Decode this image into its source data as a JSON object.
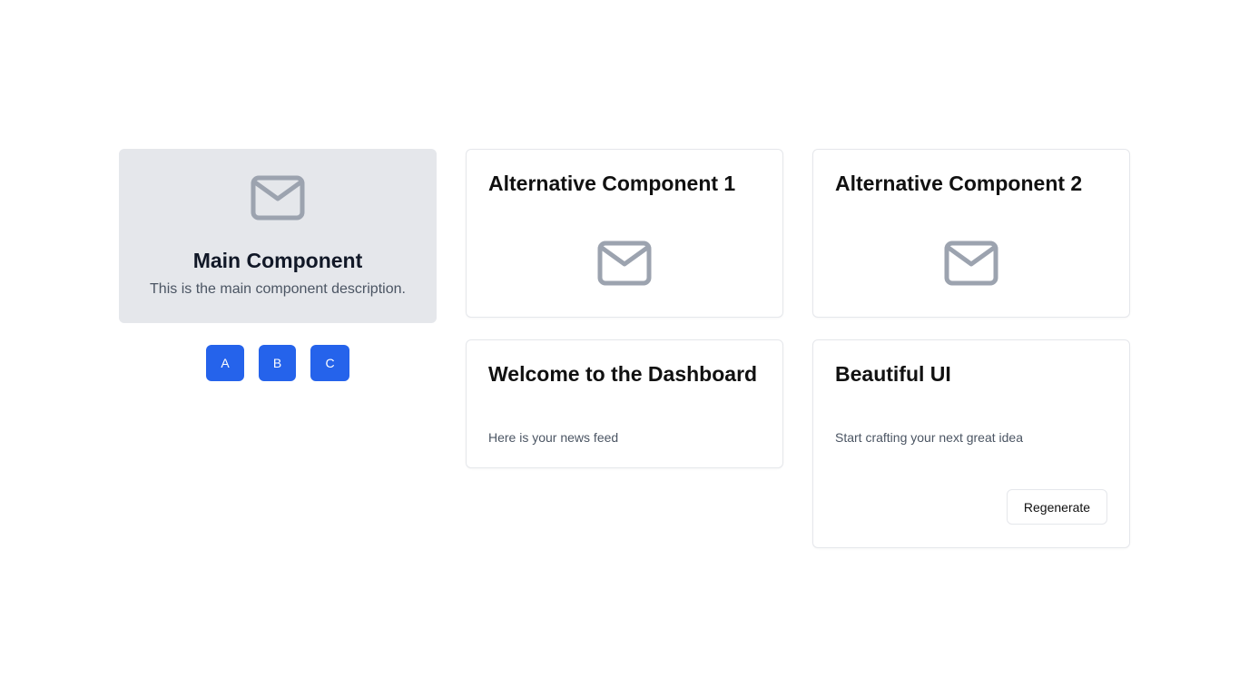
{
  "main_component": {
    "icon": "mail-icon",
    "title": "Main Component",
    "description": "This is the main component description.",
    "buttons": [
      "A",
      "B",
      "C"
    ]
  },
  "alt_component_1": {
    "title": "Alternative Component 1",
    "icon": "mail-icon"
  },
  "alt_component_2": {
    "title": "Alternative Component 2",
    "icon": "mail-icon"
  },
  "welcome_card": {
    "title": "Welcome to the Dashboard",
    "text": "Here is your news feed"
  },
  "beautiful_card": {
    "title": "Beautiful UI",
    "text": "Start crafting your next great idea",
    "button_label": "Regenerate"
  },
  "colors": {
    "accent": "#2563eb",
    "icon_gray": "#9ca3af",
    "main_card_bg": "#e5e7eb"
  }
}
